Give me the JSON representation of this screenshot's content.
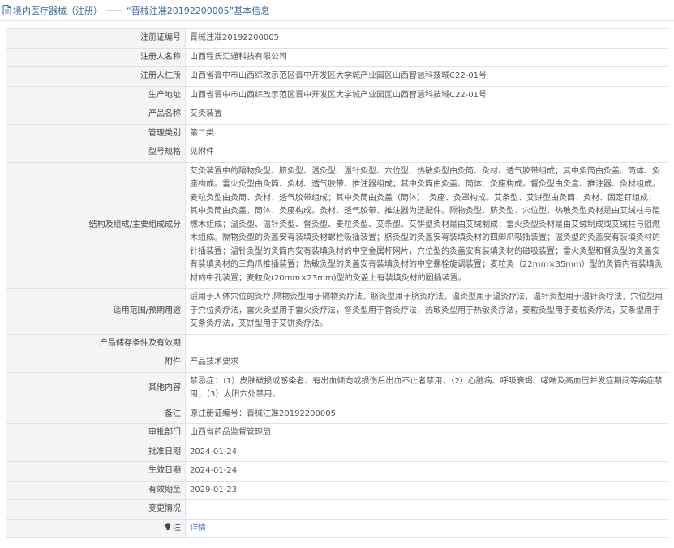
{
  "header": {
    "section": "境内医疗器械（注册）",
    "dash": "——",
    "title": "“晋械注准20192200005”基本信息"
  },
  "rows": [
    {
      "label": "注册证编号",
      "value": "晋械注准20192200005"
    },
    {
      "label": "注册人名称",
      "value": "山西程氏汇通科技有限公司"
    },
    {
      "label": "注册人住所",
      "value": "山西省晋中市山西综改示范区晋中开发区大学城产业园区山西智慧科技城C22-01号"
    },
    {
      "label": "生产地址",
      "value": "山西省晋中市山西综改示范区晋中开发区大学城产业园区山西智慧科技城C22-01号"
    },
    {
      "label": "产品名称",
      "value": "艾灸装置"
    },
    {
      "label": "管理类别",
      "value": "第二类"
    },
    {
      "label": "型号规格",
      "value": "见附件"
    },
    {
      "label": "结构及组成/主要组成成分",
      "value": "艾灸装置中的隔物灸型、脐灸型、温灸型、温针灸型、穴位型、热敏灸型由灸筒、灸材、透气胶带组成；其中灸筒由灸盖、筒体、灸座构成。雷火灸型由灸筒、灸材、透气胶带、推注器组成；其中灸筒由灸盖、筒体、灸座构成。督灸型由灸盒、推注器、灸材组成。麦粒灸型由灸筒、灸材、透气胶带组成；其中灸筒由灸盖（筒体）、灸座、灸罩构成。艾条型、艾饼型由灸筒、灸材、固定钉组成；其中灸筒由灸盖、筒体、灸座构成。灸材、透气胶带、推注器为选配件。隔物灸型、脐灸型、穴位型、热敏灸型灸材是由艾绒柱与阻燃木组成；温灸型、温针灸型、督灸型、麦粒灸型、艾条型、艾饼型灸材是由艾绒制成；雷火灸型灸材是由艾绒制成或艾绒柱与阻燃木组成。隔物灸型的灸盖安有装填灸材螺栓吸插装置；脐灸型的灸盖安有装填灸材的四脚爪吸插装置；温灸型的灸盖安有装填灸材的针插装置；温针灸型的灸筒内安有装填灸材的中空金属杆网片，穴位型的灸盖安有装填灸材的磁吸装置；雷火灸型和督灸型的灸盖安有装填灸材的三角爪推插装置；热敏灸型的灸盖安有装填灸材的中空螺栓旋调装置；麦粒灸（22mm×35mm）型的灸筒内有装填灸材的中孔装置；麦粒灸(20mm×23mm)型的灸盖上有装填灸材的圆插装置。"
    },
    {
      "label": "适用范围/预期用途",
      "value": "适用于人体穴位的灸疗.隔物灸型用于隔物灸疗法，脐灸型用于脐灸疗法，温灸型用于温灸疗法，温针灸型用于温针灸疗法，穴位型用于穴位灸疗法，雷火灸型用于雷火灸疗法，督灸型用于督灸疗法，热敏灸型用于热敏灸疗法，麦粒灸型用于麦粒灸疗法，艾条型用于艾条灸疗法，艾饼型用于艾饼灸疗法。"
    },
    {
      "label": "产品储存条件及有效期",
      "value": ""
    },
    {
      "label": "附件",
      "value": "产品技术要求"
    },
    {
      "label": "其他内容",
      "value": "禁忌症：（1）皮肤破损或感染者、有出血倾向或损伤后出血不止者禁用；（2）心脏病、呼吸衰竭、哮喘及高血压并发症期间等病症禁用；（3）太阳穴处禁用。"
    },
    {
      "label": "备注",
      "value": "原注册证编号：晋械注准20192200005"
    },
    {
      "label": "审批部门",
      "value": "山西省药品监督管理局"
    },
    {
      "label": "批准日期",
      "value": "2024-01-24"
    },
    {
      "label": "生效日期",
      "value": "2024-01-24"
    },
    {
      "label": "有效期至",
      "value": "2029-01-23"
    },
    {
      "label": "变更情况",
      "value": ""
    }
  ],
  "details": {
    "label": "注",
    "link": "详情"
  },
  "colors": {
    "link": "#3a7bd5",
    "header_text": "#3a6aa0",
    "label_bg": "#f4f5f7",
    "border": "#dfe3e8"
  }
}
